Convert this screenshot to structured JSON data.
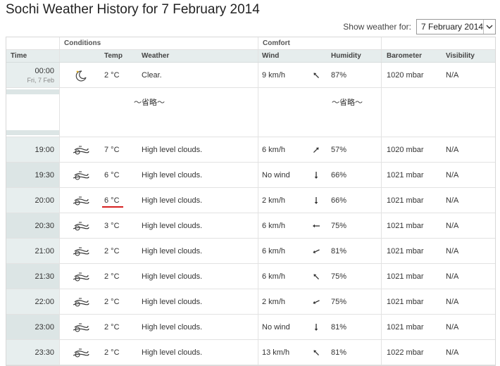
{
  "page": {
    "title": "Sochi Weather History for 7 February 2014"
  },
  "selector": {
    "label": "Show weather for:",
    "value": "7 February 2014"
  },
  "table": {
    "groups": {
      "conditions": "Conditions",
      "comfort": "Comfort"
    },
    "headers": {
      "time": "Time",
      "temp": "Temp",
      "weather": "Weather",
      "wind": "Wind",
      "humidity": "Humidity",
      "barometer": "Barometer",
      "visibility": "Visibility"
    },
    "first_row": {
      "time": "00:00",
      "date": "Fri, 7 Feb",
      "icon": "moon-icon",
      "temp": "2 °C",
      "weather": "Clear.",
      "wind": "9 km/h",
      "wind_dir": "sw-arrow-icon",
      "humidity": "87%",
      "barometer": "1020 mbar",
      "visibility": "N/A"
    },
    "omitted_label": "～省略～",
    "rows": [
      {
        "time": "19:00",
        "icon": "high-clouds-icon",
        "temp": "7 °C",
        "weather": "High level clouds.",
        "wind": "6 km/h",
        "wind_dir": "se-arrow-icon",
        "humidity": "57%",
        "barometer": "1020 mbar",
        "visibility": "N/A"
      },
      {
        "time": "19:30",
        "icon": "high-clouds-icon",
        "temp": "6 °C",
        "weather": "High level clouds.",
        "wind": "No wind",
        "wind_dir": "down-arrow-icon",
        "humidity": "66%",
        "barometer": "1021 mbar",
        "visibility": "N/A"
      },
      {
        "time": "20:00",
        "icon": "high-clouds-icon",
        "temp": "6 °C",
        "weather": "High level clouds.",
        "wind": "2 km/h",
        "wind_dir": "down-arrow-icon",
        "humidity": "66%",
        "barometer": "1021 mbar",
        "visibility": "N/A"
      },
      {
        "time": "20:30",
        "icon": "high-clouds-icon",
        "temp": "3 °C",
        "weather": "High level clouds.",
        "wind": "6 km/h",
        "wind_dir": "left-arrow-icon",
        "humidity": "75%",
        "barometer": "1021 mbar",
        "visibility": "N/A"
      },
      {
        "time": "21:00",
        "icon": "high-clouds-icon",
        "temp": "2 °C",
        "weather": "High level clouds.",
        "wind": "6 km/h",
        "wind_dir": "wsw-arrow-icon",
        "humidity": "81%",
        "barometer": "1021 mbar",
        "visibility": "N/A"
      },
      {
        "time": "21:30",
        "icon": "high-clouds-icon",
        "temp": "2 °C",
        "weather": "High level clouds.",
        "wind": "6 km/h",
        "wind_dir": "sw-arrow-icon",
        "humidity": "75%",
        "barometer": "1021 mbar",
        "visibility": "N/A"
      },
      {
        "time": "22:00",
        "icon": "high-clouds-icon",
        "temp": "2 °C",
        "weather": "High level clouds.",
        "wind": "2 km/h",
        "wind_dir": "wsw-arrow-icon",
        "humidity": "75%",
        "barometer": "1021 mbar",
        "visibility": "N/A"
      },
      {
        "time": "23:00",
        "icon": "high-clouds-icon",
        "temp": "2 °C",
        "weather": "High level clouds.",
        "wind": "No wind",
        "wind_dir": "down-arrow-icon",
        "humidity": "81%",
        "barometer": "1021 mbar",
        "visibility": "N/A"
      },
      {
        "time": "23:30",
        "icon": "high-clouds-icon",
        "temp": "2 °C",
        "weather": "High level clouds.",
        "wind": "13 km/h",
        "wind_dir": "sw-arrow-icon",
        "humidity": "81%",
        "barometer": "1022 mbar",
        "visibility": "N/A"
      }
    ]
  },
  "colors": {
    "highlight": "#d62020",
    "time_bg": "#dce5e5",
    "header_bg": "#e6eded"
  }
}
